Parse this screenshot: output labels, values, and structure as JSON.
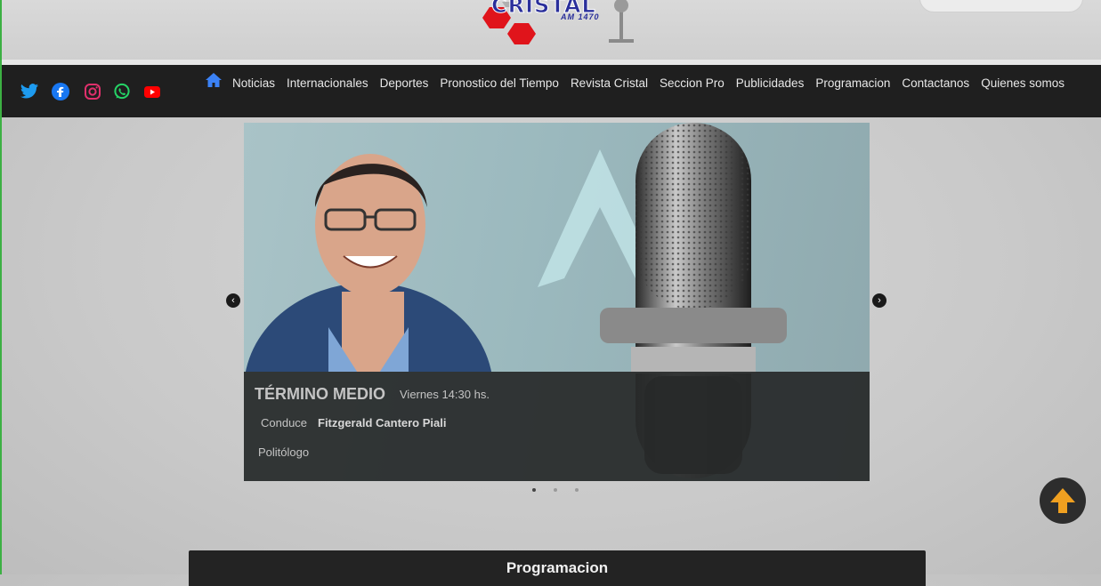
{
  "brand": {
    "logo_text": "CRISTAL",
    "logo_sub": "AM 1470",
    "colors": {
      "logo_blue": "#2a2f9b",
      "logo_red": "#e0141b",
      "navbar": "#1f1f1f"
    }
  },
  "social": [
    {
      "icon": "twitter-icon",
      "color": "#1d9bf0"
    },
    {
      "icon": "facebook-icon",
      "color": "#1877f2"
    },
    {
      "icon": "instagram-icon",
      "color": "#e1306c"
    },
    {
      "icon": "whatsapp-icon",
      "color": "#25d366"
    },
    {
      "icon": "youtube-icon",
      "color": "#ff0000"
    }
  ],
  "nav": {
    "home_icon": "home-icon",
    "items": [
      "Noticias",
      "Internacionales",
      "Deportes",
      "Pronostico del Tiempo",
      "Revista Cristal",
      "Seccion Pro",
      "Publicidades",
      "Programacion",
      "Contactanos",
      "Quienes somos"
    ]
  },
  "carousel": {
    "slide": {
      "title": "TÉRMINO MEDIO",
      "time": "Viernes 14:30 hs.",
      "host_label": "Conduce",
      "host_name": "Fitzgerald Cantero Piali",
      "role": "Politólogo"
    },
    "prev_icon": "chevron-left-icon",
    "next_icon": "chevron-right-icon",
    "slide_count": 3,
    "active_index": 0
  },
  "scroll_top_icon": "arrow-up-icon",
  "section": {
    "title": "Programacion"
  }
}
